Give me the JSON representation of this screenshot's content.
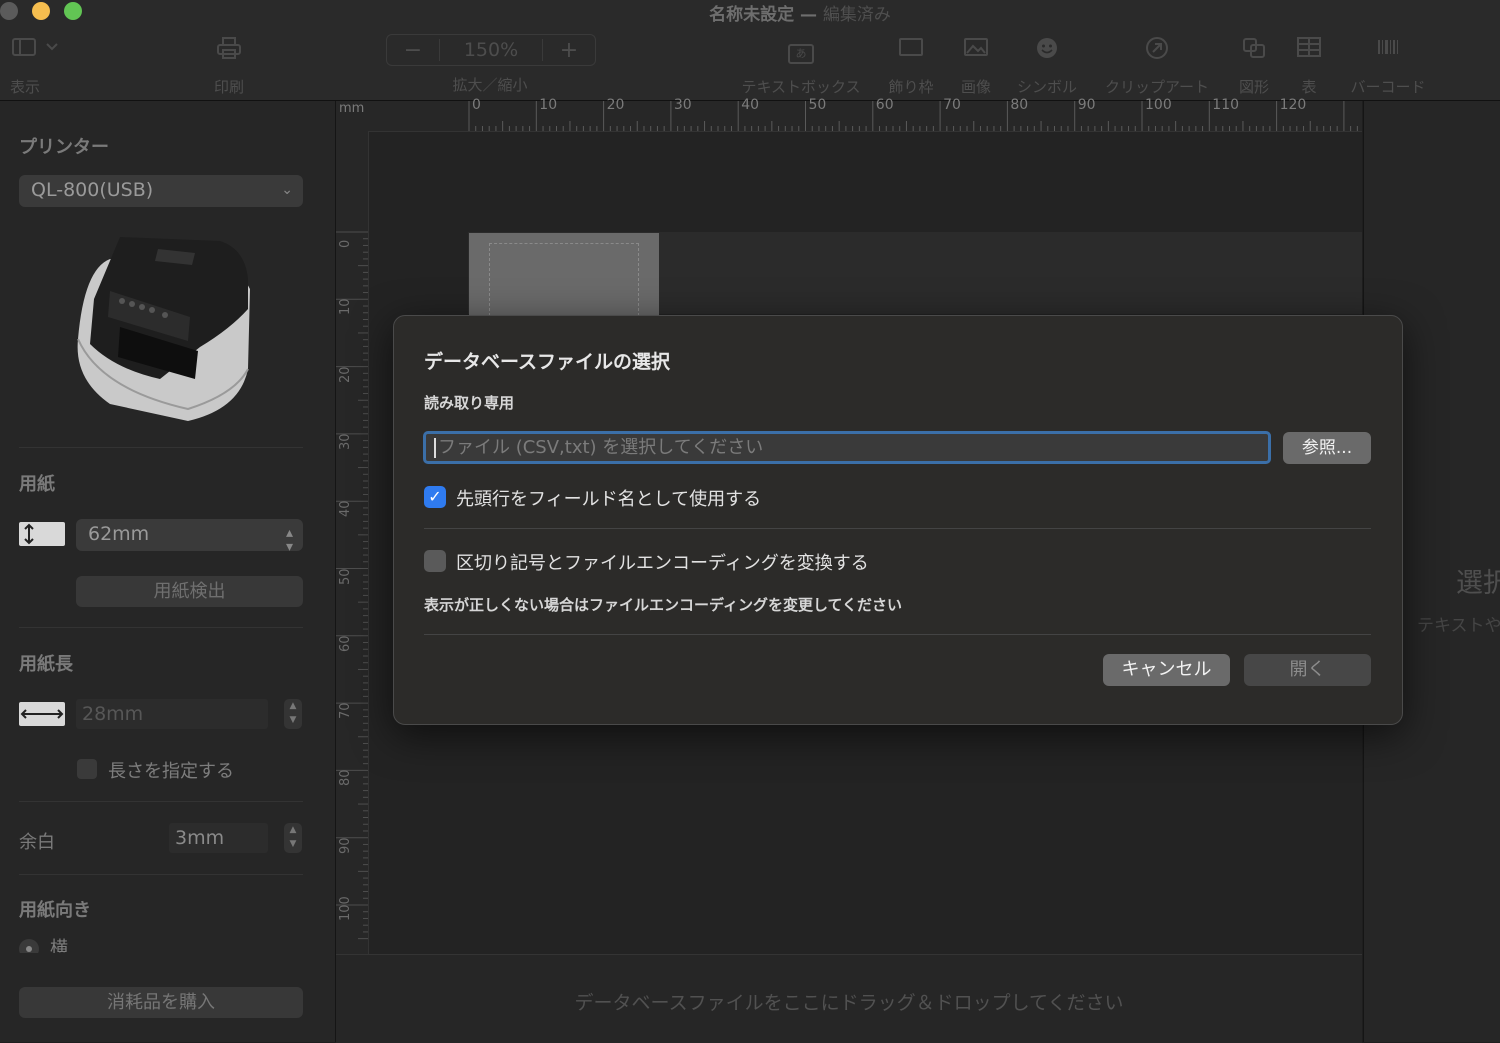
{
  "window": {
    "title": "名称未設定",
    "separator": "—",
    "subtitle": "編集済み"
  },
  "toolbar": {
    "view": "表示",
    "print": "印刷",
    "zoom_label": "拡大／縮小",
    "zoom_minus": "−",
    "zoom_value": "150%",
    "zoom_plus": "+",
    "textbox": "テキストボックス",
    "frame": "飾り枠",
    "image": "画像",
    "symbol": "シンボル",
    "clipart": "クリップアート",
    "shape": "図形",
    "table": "表",
    "barcode": "バーコード",
    "textbox_icon": "あ"
  },
  "sidebar": {
    "printer_heading": "プリンター",
    "printer_value": "QL-800(USB)",
    "paper_heading": "用紙",
    "paper_value": "62mm",
    "detect_button": "用紙検出",
    "length_heading": "用紙長",
    "length_value": "28mm",
    "specify_length": "長さを指定する",
    "margin_label": "余白",
    "margin_value": "3mm",
    "orientation_heading": "用紙向き",
    "orientation_option": "横",
    "buy_button": "消耗品を購入"
  },
  "ruler": {
    "unit": "mm",
    "top_labels": [
      "0",
      "10",
      "20",
      "30",
      "40",
      "50",
      "60",
      "70",
      "80",
      "90",
      "100",
      "110",
      "120"
    ],
    "left_labels": [
      "0",
      "10",
      "20",
      "30",
      "40",
      "50",
      "60",
      "70",
      "80",
      "90",
      "100"
    ]
  },
  "canvas": {
    "drop_hint": "データベースファイルをここにドラッグ＆ドロップしてください"
  },
  "inspector": {
    "big_text": "選択",
    "small_text": "テキストや"
  },
  "dialog": {
    "title": "データベースファイルの選択",
    "readonly": "読み取り専用",
    "file_placeholder": "ファイル (CSV,txt) を選択してください",
    "browse": "参照...",
    "first_row_label": "先頭行をフィールド名として使用する",
    "first_row_checked": true,
    "convert_label": "区切り記号とファイルエンコーディングを変換する",
    "convert_checked": false,
    "note": "表示が正しくない場合はファイルエンコーディングを変更してください",
    "cancel": "キャンセル",
    "open": "開く"
  }
}
